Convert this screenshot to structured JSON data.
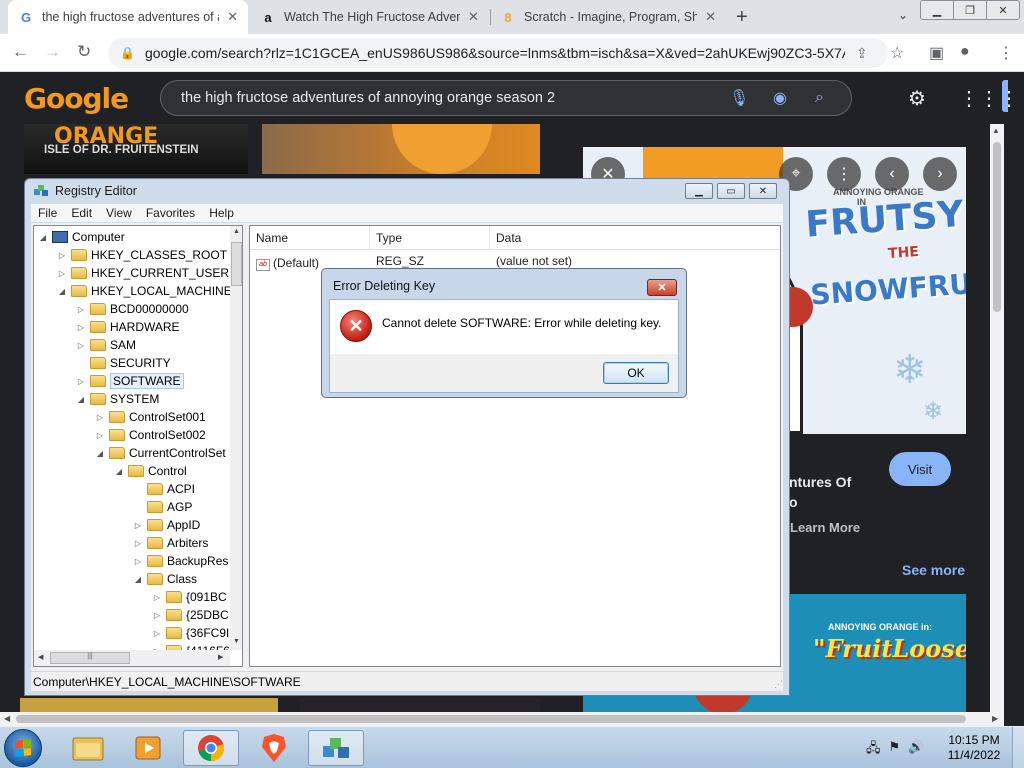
{
  "browser": {
    "tabs": [
      {
        "title": "the high fructose adventures of a",
        "favicon": "G",
        "favicon_color": "#4285f4"
      },
      {
        "title": "Watch The High Fructose Advent",
        "favicon": "a",
        "favicon_color": "#111111"
      },
      {
        "title": "Scratch - Imagine, Program, Shar",
        "favicon": "8",
        "favicon_color": "#f5a623"
      }
    ],
    "url": "google.com/search?rlz=1C1GCEA_enUS986US986&source=lnms&tbm=isch&sa=X&ved=2ahUKEwj90ZC3-5X7A..."
  },
  "google": {
    "logo": "Google",
    "query": "the high fructose adventures of annoying orange season 2"
  },
  "images": {
    "left_top_title": "ORANGE",
    "left_top_subtitle": "ISLE OF DR. FRUITENSTEIN",
    "frutsy_brand": "ANNOYING ORANGE",
    "frutsy_in": "IN",
    "frutsy_title_1": "FRUTSY",
    "frutsy_the": "THE",
    "frutsy_title_2": "SNOWFRUIT",
    "fruitloose_brand": "ANNOYING ORANGE in:",
    "fruitloose_title": "\"FruitLoose\""
  },
  "side_panel": {
    "title": "ntures Of",
    "title_line2": "o",
    "learn_more": "Learn More",
    "visit": "Visit",
    "see_more": "See more"
  },
  "regedit": {
    "title": "Registry Editor",
    "menu": [
      "File",
      "Edit",
      "View",
      "Favorites",
      "Help"
    ],
    "tree": [
      {
        "label": "Computer",
        "depth": 0,
        "exp": "open",
        "kind": "computer"
      },
      {
        "label": "HKEY_CLASSES_ROOT",
        "depth": 1,
        "exp": "closed"
      },
      {
        "label": "HKEY_CURRENT_USER",
        "depth": 1,
        "exp": "closed"
      },
      {
        "label": "HKEY_LOCAL_MACHINE",
        "depth": 1,
        "exp": "open"
      },
      {
        "label": "BCD00000000",
        "depth": 2,
        "exp": "closed"
      },
      {
        "label": "HARDWARE",
        "depth": 2,
        "exp": "closed"
      },
      {
        "label": "SAM",
        "depth": 2,
        "exp": "closed"
      },
      {
        "label": "SECURITY",
        "depth": 2,
        "exp": "none"
      },
      {
        "label": "SOFTWARE",
        "depth": 2,
        "exp": "closed",
        "selected": true
      },
      {
        "label": "SYSTEM",
        "depth": 2,
        "exp": "open"
      },
      {
        "label": "ControlSet001",
        "depth": 3,
        "exp": "closed"
      },
      {
        "label": "ControlSet002",
        "depth": 3,
        "exp": "closed"
      },
      {
        "label": "CurrentControlSet",
        "depth": 3,
        "exp": "open"
      },
      {
        "label": "Control",
        "depth": 4,
        "exp": "open"
      },
      {
        "label": "ACPI",
        "depth": 5,
        "exp": "none"
      },
      {
        "label": "AGP",
        "depth": 5,
        "exp": "none"
      },
      {
        "label": "AppID",
        "depth": 5,
        "exp": "closed"
      },
      {
        "label": "Arbiters",
        "depth": 5,
        "exp": "closed"
      },
      {
        "label": "BackupRes",
        "depth": 5,
        "exp": "closed"
      },
      {
        "label": "Class",
        "depth": 5,
        "exp": "open"
      },
      {
        "label": "{091BC",
        "depth": 6,
        "exp": "closed"
      },
      {
        "label": "{25DBC",
        "depth": 6,
        "exp": "closed"
      },
      {
        "label": "{36FC9I",
        "depth": 6,
        "exp": "closed"
      },
      {
        "label": "{4116F6",
        "depth": 6,
        "exp": "closed"
      }
    ],
    "columns": [
      "Name",
      "Type",
      "Data"
    ],
    "rows": [
      {
        "name": "(Default)",
        "type": "REG_SZ",
        "data": "(value not set)",
        "icon": "ab"
      }
    ],
    "status": "Computer\\HKEY_LOCAL_MACHINE\\SOFTWARE"
  },
  "error_dialog": {
    "title": "Error Deleting Key",
    "message": "Cannot delete SOFTWARE:  Error while deleting key.",
    "ok": "OK"
  },
  "taskbar": {
    "apps": [
      "explorer-icon",
      "media-player-icon",
      "chrome-icon",
      "brave-icon",
      "regedit-icon"
    ],
    "time": "10:15 PM",
    "date": "11/4/2022"
  },
  "colors": {
    "google_dark_bg": "#202124",
    "search_bg": "#303134",
    "accent_blue": "#8ab4f8",
    "win7_dialog_frame": "#c7d6e9",
    "error_red": "#c21a12"
  }
}
